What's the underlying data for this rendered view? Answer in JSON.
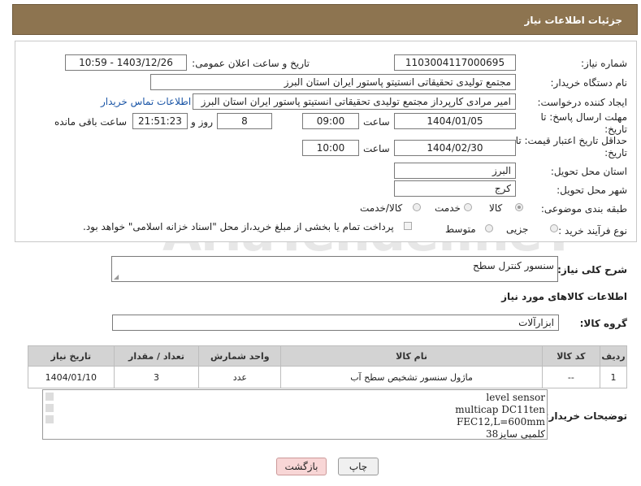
{
  "header": {
    "title": "جزئیات اطلاعات نیاز"
  },
  "form": {
    "need_number_label": "شماره نیاز:",
    "need_number": "1103004117000695",
    "announce_label": "تاریخ و ساعت اعلان عمومی:",
    "announce_value": "1403/12/26 - 10:59",
    "buyer_label": "نام دستگاه خریدار:",
    "buyer_value": "مجتمع تولیدی تحقیقاتی انستیتو پاستور ایران استان البرز",
    "creator_label": "ایجاد کننده درخواست:",
    "creator_value": "امیر مرادی کارپرداز مجتمع تولیدی تحقیقاتی انستیتو پاستور ایران استان البرز",
    "contact_link": "اطلاعات تماس خریدار",
    "deadline_label": "مهلت ارسال پاسخ: تا تاریخ:",
    "deadline_date": "1404/01/05",
    "time_label": "ساعت",
    "deadline_time": "09:00",
    "days_value": "8",
    "days_label": "روز و",
    "remaining_time": "21:51:23",
    "remaining_label": "ساعت باقی مانده",
    "validity_label": "حداقل تاریخ اعتبار قیمت: تا تاریخ:",
    "validity_date": "1404/02/30",
    "validity_time_label": "ساعت",
    "validity_time": "10:00",
    "province_label": "استان محل تحویل:",
    "province_value": "البرز",
    "city_label": "شهر محل تحویل:",
    "city_value": "کرج",
    "category_label": "طبقه بندی موضوعی:",
    "category_options": [
      "کالا",
      "خدمت",
      "کالا/خدمت"
    ],
    "category_selected": "کالا",
    "process_label": "نوع فرآیند خرید :",
    "process_options": [
      "جزیی",
      "متوسط"
    ],
    "payment_note": "پرداخت تمام یا بخشی از مبلغ خرید،از محل \"اسناد خزانه اسلامی\" خواهد بود."
  },
  "description": {
    "label": "شرح کلی نیاز:",
    "value": "سنسور کنترل سطح"
  },
  "items_section": {
    "title": "اطلاعات کالاهای مورد نیاز",
    "group_label": "گروه کالا:",
    "group_value": "ابزارآلات"
  },
  "table": {
    "headers": [
      "ردیف",
      "کد کالا",
      "نام کالا",
      "واحد شمارش",
      "تعداد / مقدار",
      "تاریخ نیاز"
    ],
    "rows": [
      [
        "1",
        "--",
        "ماژول سنسور تشخیص سطح آب",
        "عدد",
        "3",
        "1404/01/10"
      ]
    ]
  },
  "buyer_notes": {
    "label": "توضیحات خریدار:",
    "lines": [
      "level sensor",
      "multicap DC11ten",
      "FEC12,L=600mm",
      "کلمپی سایز38"
    ]
  },
  "buttons": {
    "print": "چاپ",
    "back": "بازگشت"
  },
  "watermark": "AriaTender.neT",
  "colors": {
    "header_bg": "#8d7450",
    "link": "#1a55a6",
    "back_button_bg": "#f8d6d6"
  }
}
